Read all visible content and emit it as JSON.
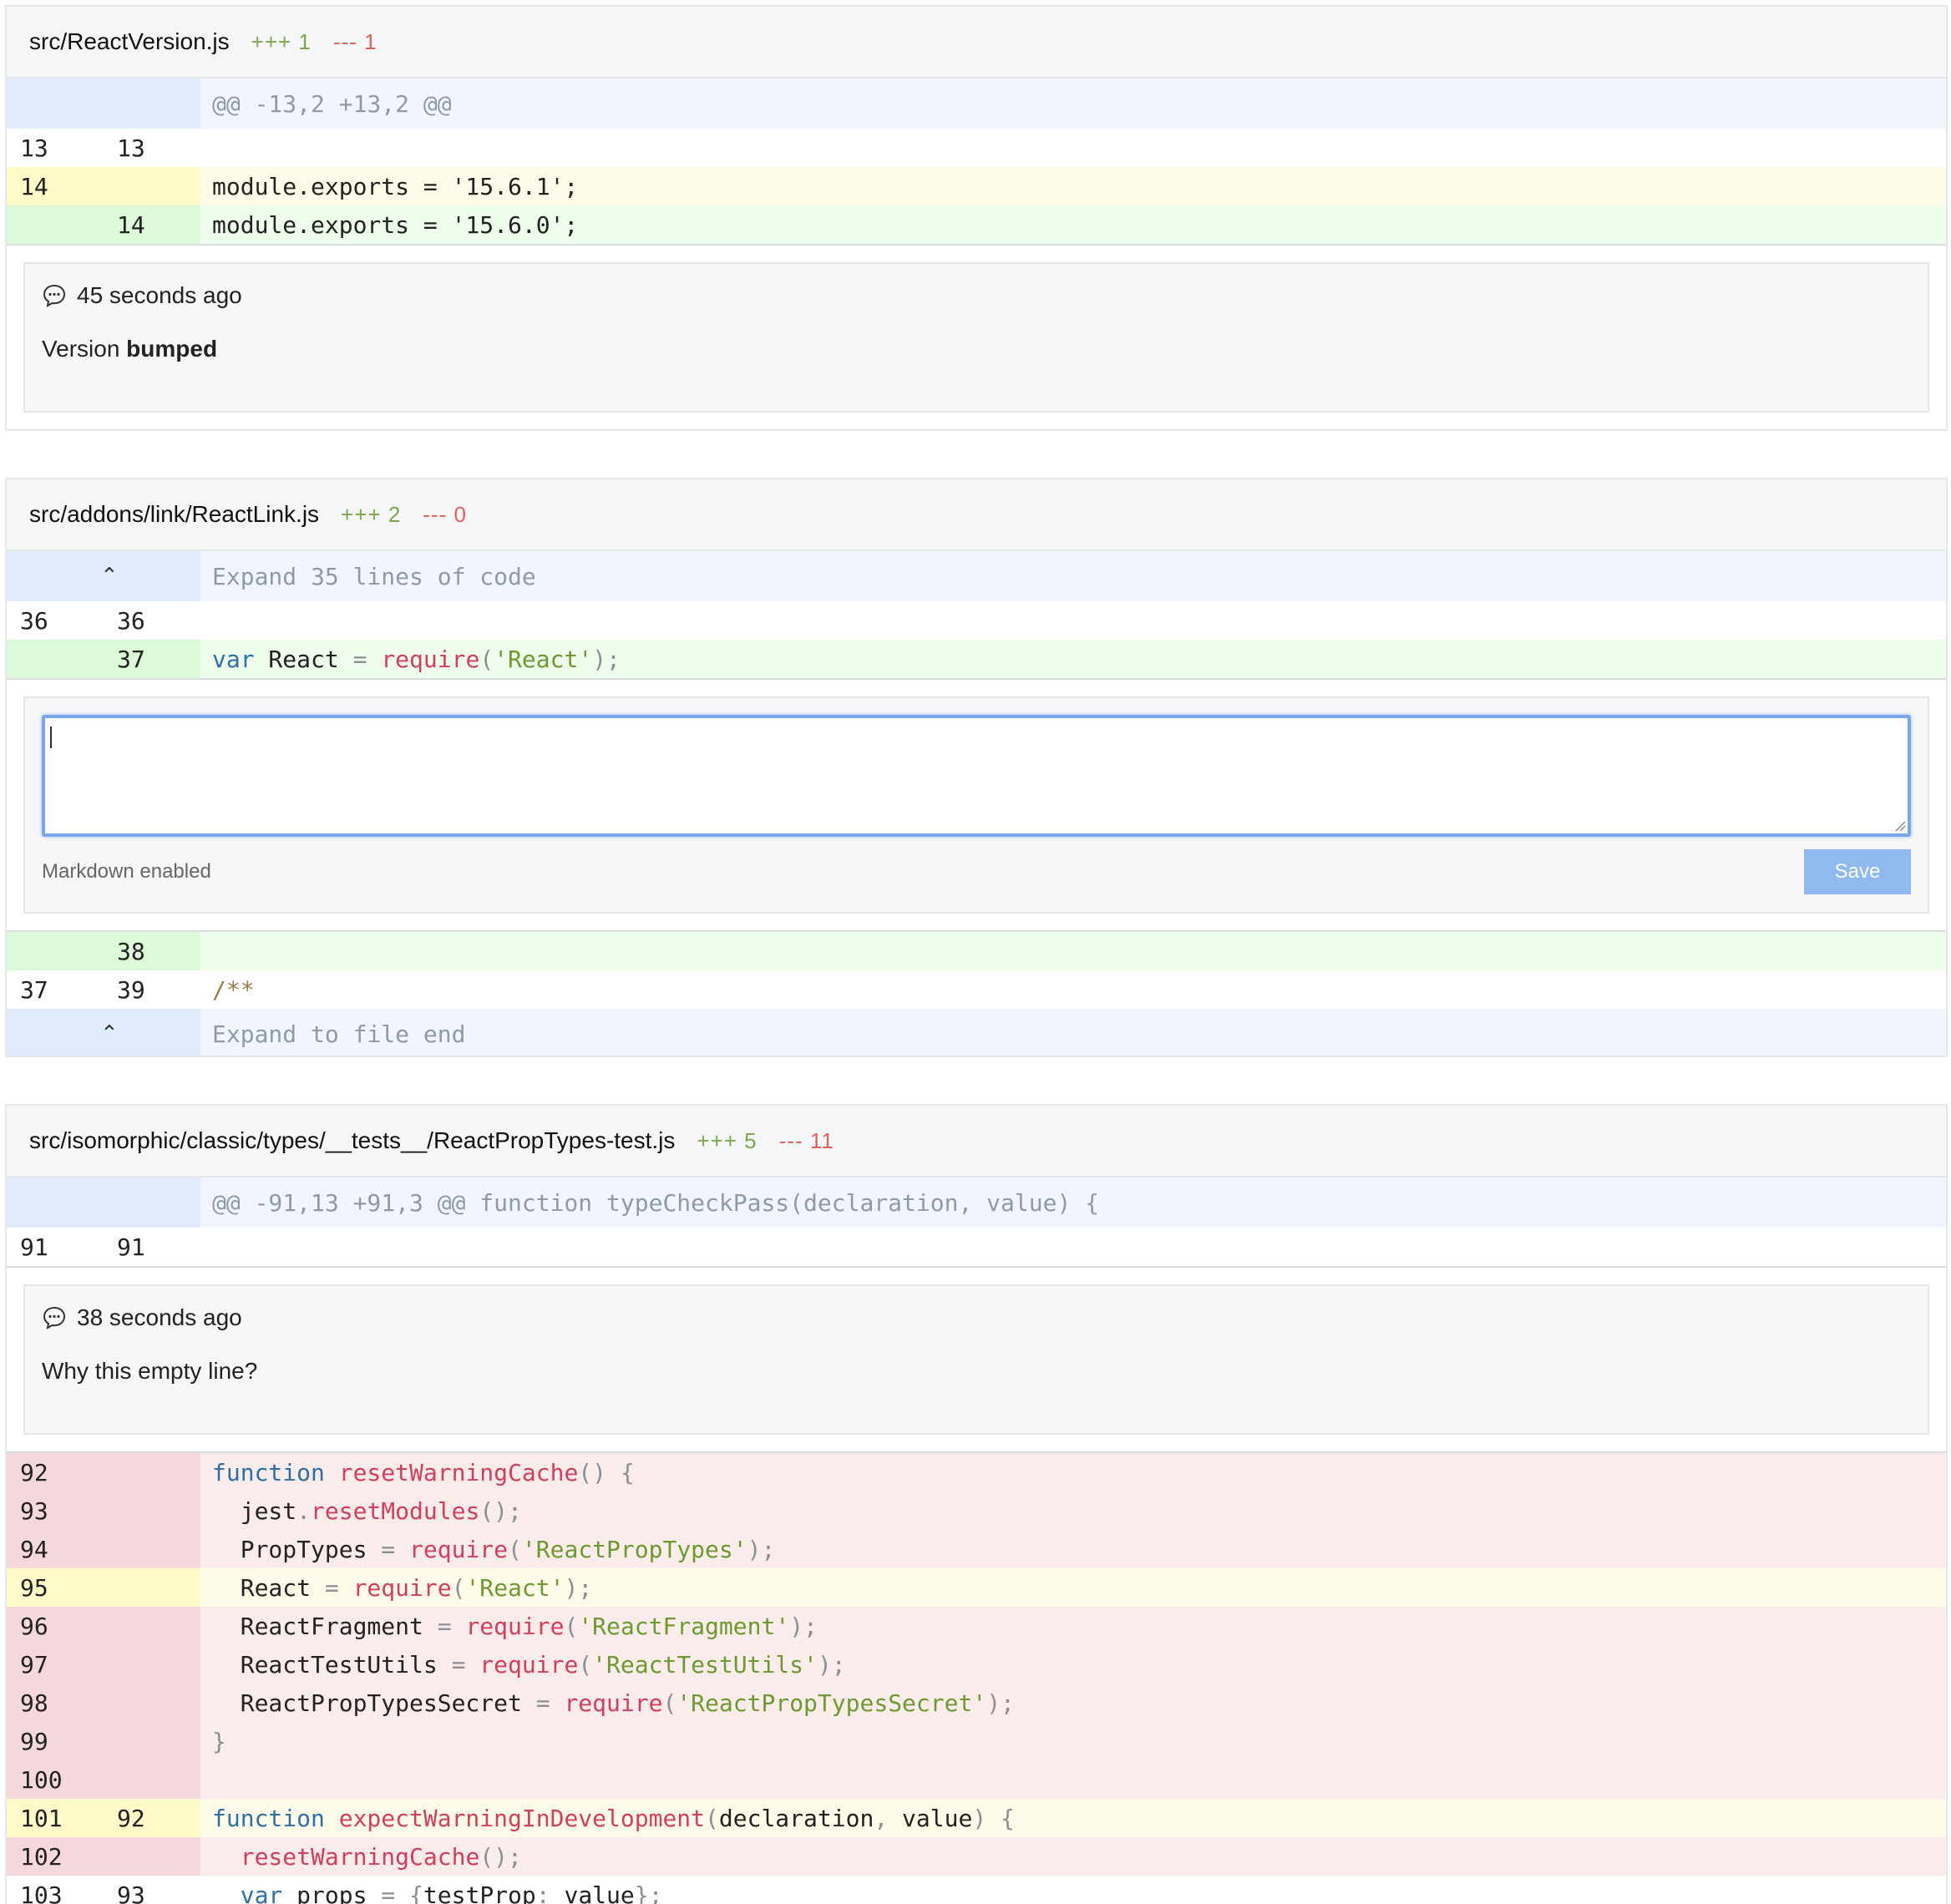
{
  "files": [
    {
      "path": "src/ReactVersion.js",
      "additions": "+++ 1",
      "deletions": "--- 1",
      "hunk": "@@ -13,2 +13,2 @@",
      "lines": [
        {
          "old": "13",
          "new": "13",
          "type": "normal"
        },
        {
          "old": "14",
          "new": "",
          "type": "changed",
          "text": "module.exports = '15.6.1';"
        },
        {
          "old": "",
          "new": "14",
          "type": "added",
          "text": "module.exports = '15.6.0';"
        }
      ],
      "comment": {
        "time": "45 seconds ago",
        "body_prefix": "Version ",
        "body_bold": "bumped"
      }
    },
    {
      "path": "src/addons/link/ReactLink.js",
      "additions": "+++ 2",
      "deletions": "--- 0",
      "expand_top": "Expand 35 lines of code",
      "lines_before": [
        {
          "old": "36",
          "new": "36"
        },
        {
          "old": "",
          "new": "37",
          "text": "var React = require('React');"
        }
      ],
      "editor": {
        "value": "",
        "placeholder": "",
        "note": "Markdown enabled",
        "save_label": "Save"
      },
      "lines_after": [
        {
          "old": "",
          "new": "38"
        },
        {
          "old": "37",
          "new": "39",
          "text": "/**"
        }
      ],
      "expand_bottom": "Expand to file end"
    },
    {
      "path": "src/isomorphic/classic/types/__tests__/ReactPropTypes-test.js",
      "additions": "+++ 5",
      "deletions": "--- 11",
      "hunk": "@@ -91,13 +91,3 @@ function typeCheckPass(declaration, value) {",
      "lines_before": [
        {
          "old": "91",
          "new": "91"
        }
      ],
      "comment": {
        "time": "38 seconds ago",
        "body": "Why this empty line?"
      },
      "lines_after": [
        {
          "old": "92",
          "new": "",
          "type": "removed",
          "text": "function resetWarningCache() {"
        },
        {
          "old": "93",
          "new": "",
          "type": "removed",
          "text": "  jest.resetModules();"
        },
        {
          "old": "94",
          "new": "",
          "type": "removed",
          "text": "  PropTypes = require('ReactPropTypes');"
        },
        {
          "old": "95",
          "new": "",
          "type": "changed",
          "text": "  React = require('React');"
        },
        {
          "old": "96",
          "new": "",
          "type": "removed",
          "text": "  ReactFragment = require('ReactFragment');"
        },
        {
          "old": "97",
          "new": "",
          "type": "removed",
          "text": "  ReactTestUtils = require('ReactTestUtils');"
        },
        {
          "old": "98",
          "new": "",
          "type": "removed",
          "text": "  ReactPropTypesSecret = require('ReactPropTypesSecret');"
        },
        {
          "old": "99",
          "new": "",
          "type": "removed",
          "text": "}"
        },
        {
          "old": "100",
          "new": "",
          "type": "removed",
          "text": ""
        },
        {
          "old": "101",
          "new": "92",
          "type": "changed",
          "text": "function expectWarningInDevelopment(declaration, value) {"
        },
        {
          "old": "102",
          "new": "",
          "type": "removed",
          "text": "  resetWarningCache();"
        },
        {
          "old": "103",
          "new": "93",
          "type": "normal",
          "text": "  var props = {testProp: value};"
        }
      ]
    }
  ],
  "icons": {
    "comment": "comment-bubble-icon",
    "expand": "expand-vertical-icon",
    "resize": "resize-grip-icon"
  },
  "colors": {
    "addition": "#7ba84b",
    "deletion": "#e4615b",
    "focus_border": "#7aa7ec",
    "save_button": "#8fb9ef"
  }
}
